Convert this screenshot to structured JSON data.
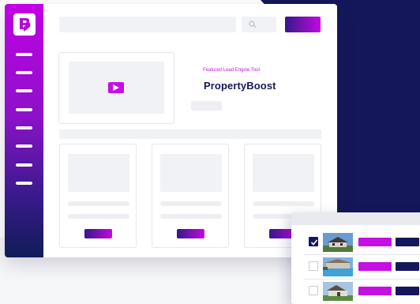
{
  "app": {
    "brand_icon": "brand-b-logo-icon",
    "accent_colors": {
      "magenta": "#c50fe3",
      "navy": "#14185a",
      "purple": "#34188a"
    }
  },
  "sidebar": {
    "menu_item_count_visual": 8
  },
  "header": {
    "search_icon": "search-icon"
  },
  "featured": {
    "label": "Featured Lead Engine Tool",
    "title": "PropertyBoost",
    "video_icon": "play-icon"
  },
  "listings_panel": {
    "rows": [
      {
        "checked": true,
        "image": "house-exterior-1"
      },
      {
        "checked": false,
        "image": "house-pool"
      },
      {
        "checked": false,
        "image": "house-exterior-2"
      }
    ]
  }
}
